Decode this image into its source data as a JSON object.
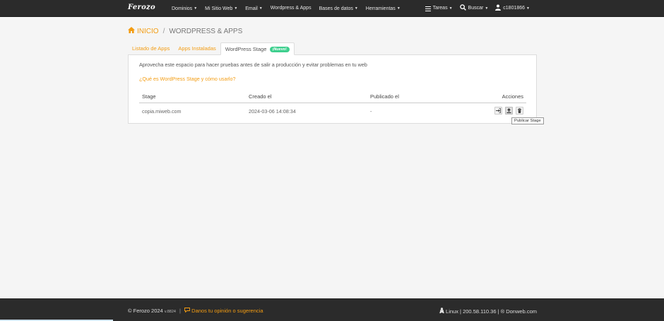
{
  "navbar": {
    "logo": "Ferozo",
    "menu": [
      {
        "label": "Dominios"
      },
      {
        "label": "Mi Sitio Web"
      },
      {
        "label": "Email"
      },
      {
        "label": "Wordpress & Apps"
      },
      {
        "label": "Bases de datos"
      },
      {
        "label": "Herramientas"
      }
    ],
    "tasks_label": "Tareas",
    "search_label": "Buscar",
    "user_label": "c1801866"
  },
  "breadcrumb": {
    "home_label": "INICIO",
    "separator": "/",
    "current": "WORDPRESS & APPS"
  },
  "tabs": [
    {
      "label": "Listado de Apps",
      "active": false
    },
    {
      "label": "Apps Instaladas",
      "active": false
    },
    {
      "label": "WordPress Stage",
      "active": true,
      "badge": "¡Nuevo!"
    }
  ],
  "panel": {
    "intro": "Aprovecha este espacio para hacer pruebas antes de salir a producción y evitar problemas en tu web",
    "help_link": "¿Qué es WordPress Stage y cómo usarlo?",
    "table": {
      "headers": [
        "Stage",
        "Creado el",
        "Publicado el",
        "Acciones"
      ],
      "rows": [
        {
          "stage": "copia.miweb.com",
          "created": "2024-03-06 14:08:34",
          "published": "-"
        }
      ]
    },
    "tooltip": "Publicar Stage"
  },
  "footer": {
    "copyright": "© Ferozo 2024",
    "version": "v.8824",
    "opinion": "Danos tu opinión o sugerencia",
    "server_info": "Linux | 200.58.110.36 | ® Donweb.com"
  },
  "colors": {
    "accent": "#f39c12",
    "navbar_bg": "#2b2b2b",
    "badge": "#3ecf8e"
  }
}
